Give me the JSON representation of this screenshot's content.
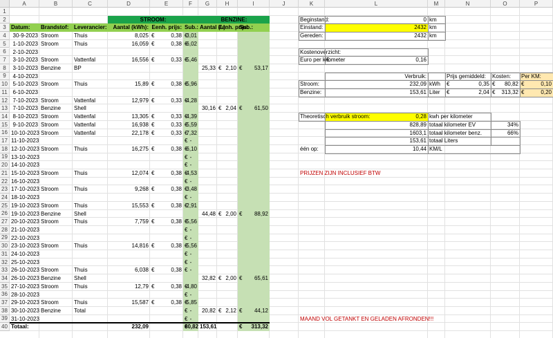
{
  "colors": {
    "green_header": "#1aa34a",
    "green_subheader": "#92d050",
    "green_column": "#c6e0b4",
    "highlight_yellow": "#ffff00",
    "highlight_peach": "#ffe8b0",
    "red_text": "#c00000"
  },
  "columns": [
    "A",
    "B",
    "C",
    "D",
    "E",
    "F",
    "G",
    "H",
    "I",
    "J",
    "K",
    "L",
    "M",
    "N",
    "O",
    "P"
  ],
  "rows": [
    1,
    2,
    3,
    4,
    5,
    6,
    7,
    8,
    9,
    10,
    11,
    12,
    13,
    14,
    15,
    16,
    17,
    18,
    19,
    20,
    21,
    22,
    23,
    24,
    25,
    26,
    27,
    28,
    29,
    30,
    31,
    32,
    33,
    34,
    35,
    36,
    37,
    38,
    39,
    40
  ],
  "sections": {
    "stroom": "STROOM:",
    "benzine": "BENZINE:"
  },
  "table_headers": [
    "Datum:",
    "Brandstof:",
    "Leverancier:",
    "Aantal (kWh):",
    "Eenh. prijs:",
    "Sub.:",
    "Aantal (L):",
    "Eenh. prijs:",
    "Sub.:"
  ],
  "entries": [
    [
      "30-9-2023",
      "Stroom",
      "Thuis",
      "8,025",
      "€",
      "0,38",
      "€",
      "3,01",
      "",
      "",
      "",
      "",
      ""
    ],
    [
      "1-10-2023",
      "Stroom",
      "Thuis",
      "16,059",
      "€",
      "0,38",
      "€",
      "6,02",
      "",
      "",
      "",
      "",
      ""
    ],
    [
      "2-10-2023",
      "",
      "",
      "",
      "",
      "",
      "",
      "",
      "",
      "",
      "",
      "",
      ""
    ],
    [
      "3-10-2023",
      "Stroom",
      "Vattenfal",
      "16,556",
      "€",
      "0,33",
      "€",
      "5,46",
      "",
      "",
      "",
      "",
      ""
    ],
    [
      "3-10-2023",
      "Benzine",
      "BP",
      "",
      "",
      "",
      "",
      "",
      "25,33",
      "€",
      "2,10",
      "€",
      "53,17"
    ],
    [
      "4-10-2023",
      "",
      "",
      "",
      "",
      "",
      "",
      "",
      "",
      "",
      "",
      "",
      ""
    ],
    [
      "5-10-2023",
      "Stroom",
      "Thuis",
      "15,89",
      "€",
      "0,38",
      "€",
      "5,96",
      "",
      "",
      "",
      "",
      ""
    ],
    [
      "6-10-2023",
      "",
      "",
      "",
      "",
      "",
      "",
      "",
      "",
      "",
      "",
      "",
      ""
    ],
    [
      "7-10-2023",
      "Stroom",
      "Vattenfal",
      "12,979",
      "€",
      "0,33",
      "€",
      "4,28",
      "",
      "",
      "",
      "",
      ""
    ],
    [
      "7-10-2023",
      "Benzine",
      "Shell",
      "",
      "",
      "",
      "",
      "",
      "30,16",
      "€",
      "2,04",
      "€",
      "61,50"
    ],
    [
      "8-10-2023",
      "Stroom",
      "Vattenfal",
      "13,305",
      "€",
      "0,33",
      "€",
      "4,39",
      "",
      "",
      "",
      "",
      ""
    ],
    [
      "9-10-2023",
      "Stroom",
      "Vattenfal",
      "16,938",
      "€",
      "0,33",
      "€",
      "5,59",
      "",
      "",
      "",
      "",
      ""
    ],
    [
      "10-10-2023",
      "Stroom",
      "Vattenfal",
      "22,178",
      "€",
      "0,33",
      "€",
      "7,32",
      "",
      "",
      "",
      "",
      ""
    ],
    [
      "11-10-2023",
      "",
      "",
      "",
      "",
      "",
      "€",
      "-",
      "",
      "",
      "",
      "",
      ""
    ],
    [
      "12-10-2023",
      "Stroom",
      "Thuis",
      "16,275",
      "€",
      "0,38",
      "€",
      "6,10",
      "",
      "",
      "",
      "",
      ""
    ],
    [
      "13-10-2023",
      "",
      "",
      "",
      "",
      "",
      "€",
      "-",
      "",
      "",
      "",
      "",
      ""
    ],
    [
      "14-10-2023",
      "",
      "",
      "",
      "",
      "",
      "€",
      "-",
      "",
      "",
      "",
      "",
      ""
    ],
    [
      "15-10-2023",
      "Stroom",
      "Thuis",
      "12,074",
      "€",
      "0,38",
      "€",
      "4,53",
      "",
      "",
      "",
      "",
      ""
    ],
    [
      "16-10-2023",
      "",
      "",
      "",
      "",
      "",
      "€",
      "-",
      "",
      "",
      "",
      "",
      ""
    ],
    [
      "17-10-2023",
      "Stroom",
      "Thuis",
      "9,268",
      "€",
      "0,38",
      "€",
      "3,48",
      "",
      "",
      "",
      "",
      ""
    ],
    [
      "18-10-2023",
      "",
      "",
      "",
      "",
      "",
      "€",
      "-",
      "",
      "",
      "",
      "",
      ""
    ],
    [
      "19-10-2023",
      "Stroom",
      "Thuis",
      "15,553",
      "€",
      "0,38",
      "€",
      "2,91",
      "",
      "",
      "",
      "",
      ""
    ],
    [
      "19-10-2023",
      "Benzine",
      "Shell",
      "",
      "",
      "",
      "",
      "",
      "44,48",
      "€",
      "2,00",
      "€",
      "88,92"
    ],
    [
      "20-10-2023",
      "Stroom",
      "Thuis",
      "7,759",
      "€",
      "0,38",
      "€",
      "5,56",
      "",
      "",
      "",
      "",
      ""
    ],
    [
      "21-10-2023",
      "",
      "",
      "",
      "",
      "",
      "€",
      "-",
      "",
      "",
      "",
      "",
      ""
    ],
    [
      "22-10-2023",
      "",
      "",
      "",
      "",
      "",
      "€",
      "-",
      "",
      "",
      "",
      "",
      ""
    ],
    [
      "23-10-2023",
      "Stroom",
      "Thuis",
      "14,816",
      "€",
      "0,38",
      "€",
      "5,56",
      "",
      "",
      "",
      "",
      ""
    ],
    [
      "24-10-2023",
      "",
      "",
      "",
      "",
      "",
      "€",
      "-",
      "",
      "",
      "",
      "",
      ""
    ],
    [
      "25-10-2023",
      "",
      "",
      "",
      "",
      "",
      "€",
      "-",
      "",
      "",
      "",
      "",
      ""
    ],
    [
      "26-10-2023",
      "Stroom",
      "Thuis",
      "6,038",
      "€",
      "0,38",
      "€",
      "-",
      "",
      "",
      "",
      "",
      ""
    ],
    [
      "26-10-2023",
      "Benzine",
      "Shell",
      "",
      "",
      "",
      "",
      "",
      "32,82",
      "€",
      "2,00",
      "€",
      "65,61"
    ],
    [
      "27-10-2023",
      "Stroom",
      "Thuis",
      "12,79",
      "€",
      "0,38",
      "€",
      "4,80",
      "",
      "",
      "",
      "",
      ""
    ],
    [
      "28-10-2023",
      "",
      "",
      "",
      "",
      "",
      "€",
      "-",
      "",
      "",
      "",
      "",
      ""
    ],
    [
      "29-10-2023",
      "Stroom",
      "Thuis",
      "15,587",
      "€",
      "0,38",
      "€",
      "5,85",
      "",
      "",
      "",
      "",
      ""
    ],
    [
      "30-10-2023",
      "Benzine",
      "Total",
      "",
      "",
      "",
      "€",
      "-",
      "20,82",
      "€",
      "2,12",
      "€",
      "44,12"
    ],
    [
      "31-10-2023",
      "",
      "",
      "",
      "",
      "",
      "€",
      "-",
      "",
      "",
      "",
      "",
      ""
    ]
  ],
  "totals": {
    "label": "Totaal:",
    "kwh": "232,09",
    "euro": "€",
    "stroom_sub": "80,82",
    "liters": "153,61",
    "benzine_sub": "313,32"
  },
  "odometer": [
    {
      "label": "Beginstand:",
      "value": "0",
      "unit": "km"
    },
    {
      "label": "Einstand:",
      "value": "2432",
      "unit": "km"
    },
    {
      "label": "Gereden:",
      "value": "2432",
      "unit": "km"
    }
  ],
  "kosten": {
    "title": "Kostenoverzicht:",
    "label": "Euro per kilometer",
    "euro": "€",
    "value": "0,16"
  },
  "summary": {
    "headers": [
      "Verbruik:",
      "Prijs gemiddeld:",
      "Kosten:",
      "Per KM:"
    ],
    "rows": [
      {
        "label": "Stroom:",
        "verbruik": "232,09",
        "unit": "kWh",
        "prijs_euro": "€",
        "prijs": "0,35",
        "kosten_euro": "€",
        "kosten": "80,82",
        "km_euro": "€",
        "per_km": "0,10"
      },
      {
        "label": "Benzine:",
        "verbruik": "153,61",
        "unit": "Liter",
        "prijs_euro": "€",
        "prijs": "2,04",
        "kosten_euro": "€",
        "kosten": "313,32",
        "km_euro": "€",
        "per_km": "0,20"
      }
    ]
  },
  "theoretical": {
    "label": "Theoretisch verbruik stroom:",
    "value": "0,28",
    "unit": "kwh per kilometer",
    "rows": [
      {
        "value": "828,89",
        "label": "totaal kilometer EV",
        "pct": "34%"
      },
      {
        "value": "1603,1",
        "label": "totaal kilometer benz.",
        "pct": "66%"
      },
      {
        "value": "153,61",
        "label": "totaal Liters",
        "pct": ""
      }
    ],
    "een_op_label": "één op:",
    "een_op_value": "10,44",
    "een_op_unit": "KM/L"
  },
  "notes": {
    "btw": "PRIJZEN ZIJN INCLUSIEF BTW",
    "afronden": "MAAND  VOL GETANKT EN GELADEN AFRONDEN!!!"
  }
}
